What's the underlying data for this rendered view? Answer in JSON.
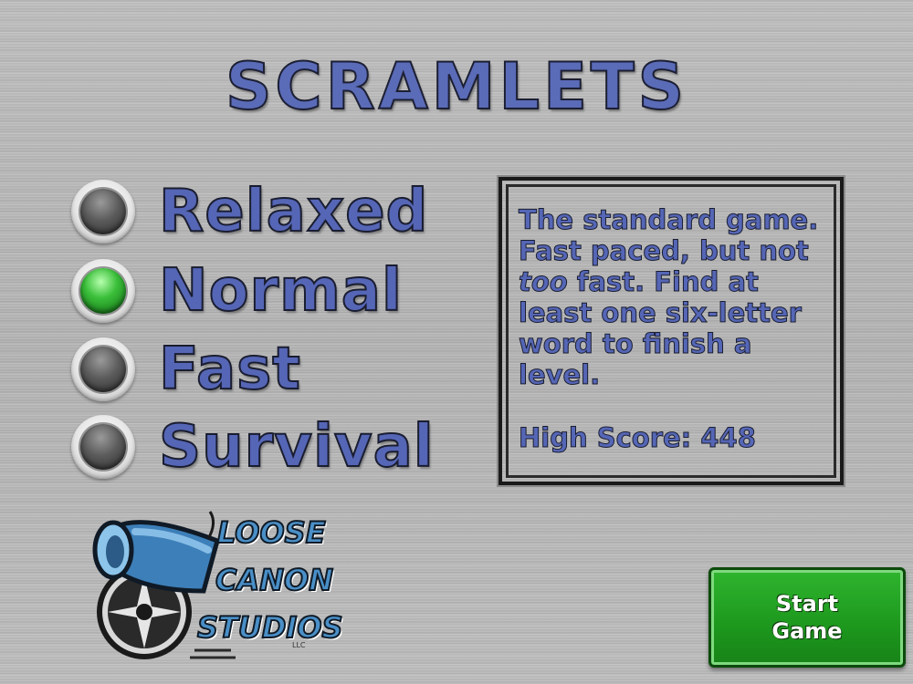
{
  "title": "SCRAMLETS",
  "modes": [
    {
      "label": "Relaxed",
      "selected": false
    },
    {
      "label": "Normal",
      "selected": true
    },
    {
      "label": "Fast",
      "selected": false
    },
    {
      "label": "Survival",
      "selected": false
    }
  ],
  "info": {
    "desc_part1": "The standard game. Fast paced, but not ",
    "desc_emph": "too",
    "desc_part2": " fast. Find at least one six-letter word to finish a level.",
    "high_score": "High Score: 448"
  },
  "start_button": {
    "line1": "Start",
    "line2": "Game"
  },
  "logo": {
    "line1": "LOOSE",
    "line2": "CANON",
    "line3": "STUDIOS",
    "suffix": "LLC"
  },
  "colors": {
    "accent_blue": "#5566b6",
    "button_green": "#1e9a1e",
    "lamp_on": "#3bbf3a"
  }
}
